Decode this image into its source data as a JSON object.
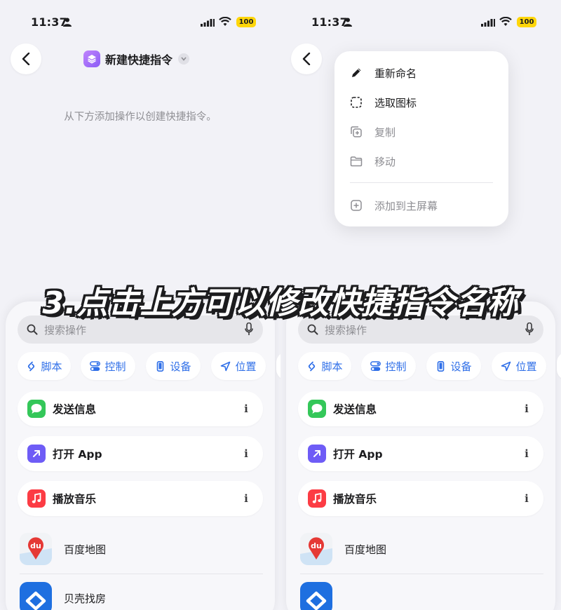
{
  "colors": {
    "accent_blue": "#2f6fe8",
    "battery_yellow": "#ffd60a",
    "messages_green": "#34c759",
    "openapp_purple": "#6e5cf6",
    "music_red": "#fc3c44"
  },
  "panes": [
    {
      "status": {
        "time": "11:37",
        "battery": "100"
      },
      "header": {
        "title": "新建快捷指令"
      },
      "hint": "从下方添加操作以创建快捷指令。",
      "search": {
        "placeholder": "搜索操作"
      },
      "chips": [
        {
          "label": "脚本",
          "icon": "script-icon"
        },
        {
          "label": "控制",
          "icon": "toggle-icon"
        },
        {
          "label": "设备",
          "icon": "phone-icon"
        },
        {
          "label": "位置",
          "icon": "location-arrow-icon"
        }
      ],
      "actions": [
        {
          "label": "发送信息",
          "icon": "messages-icon"
        },
        {
          "label": "打开 App",
          "icon": "open-app-icon"
        },
        {
          "label": "播放音乐",
          "icon": "music-icon"
        }
      ],
      "apps": [
        {
          "label": "百度地图",
          "icon": "baidu-maps-icon",
          "icon_text": "du"
        },
        {
          "label": "贝壳找房",
          "icon": "beike-icon"
        }
      ]
    },
    {
      "status": {
        "time": "11:37",
        "battery": "100"
      },
      "menu": {
        "items": [
          {
            "label": "重新命名",
            "icon": "pencil-icon"
          },
          {
            "label": "选取图标",
            "icon": "dashed-square-icon"
          },
          {
            "label": "复制",
            "icon": "duplicate-icon"
          },
          {
            "label": "移动",
            "icon": "folder-icon"
          },
          {
            "label": "添加到主屏幕",
            "icon": "add-square-icon"
          }
        ]
      },
      "search": {
        "placeholder": "搜索操作"
      },
      "chips": [
        {
          "label": "脚本",
          "icon": "script-icon"
        },
        {
          "label": "控制",
          "icon": "toggle-icon"
        },
        {
          "label": "设备",
          "icon": "phone-icon"
        },
        {
          "label": "位置",
          "icon": "location-arrow-icon"
        }
      ],
      "actions": [
        {
          "label": "发送信息",
          "icon": "messages-icon"
        },
        {
          "label": "打开 App",
          "icon": "open-app-icon"
        },
        {
          "label": "播放音乐",
          "icon": "music-icon"
        }
      ],
      "apps": [
        {
          "label": "百度地图",
          "icon": "baidu-maps-icon",
          "icon_text": "du"
        }
      ]
    }
  ],
  "caption": "3.点击上方可以修改快捷指令名称",
  "info_glyph": "i"
}
